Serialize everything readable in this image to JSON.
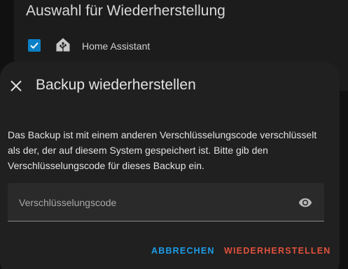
{
  "background": {
    "section_title": "Auswahl für Wiederherstellung",
    "addon_label": "Home Assistant",
    "addon_checked": true
  },
  "dialog": {
    "title": "Backup wiederherstellen",
    "message": "Das Backup ist mit einem anderen Verschlüsselungscode verschlüsselt als der, der auf diesem System gespeichert ist. Bitte gib den Verschlüsselungscode für dieses Backup ein.",
    "input_placeholder": "Verschlüsselungscode",
    "input_value": "",
    "cancel_label": "ABBRECHEN",
    "restore_label": "WIEDERHERSTELLEN"
  },
  "colors": {
    "accent_blue": "#1e9ce8",
    "danger_red": "#e0513d",
    "checkbox_blue": "#0b80c6"
  },
  "icons": [
    "close-icon",
    "checkbox-checked-icon",
    "home-assistant-icon",
    "eye-icon"
  ]
}
